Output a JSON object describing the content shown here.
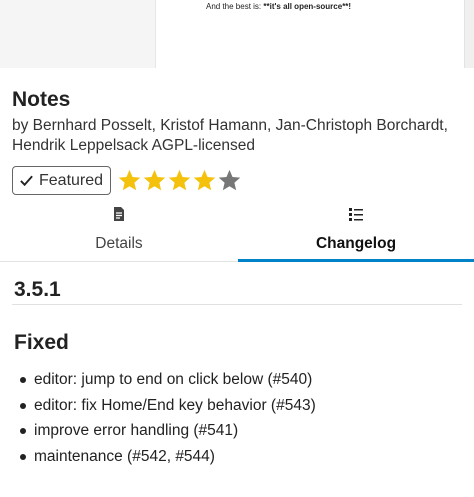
{
  "screenshot_strip": {
    "caption_prefix": "And the best is: ",
    "caption_bold": "**it's all open-source**!"
  },
  "app": {
    "title": "Notes",
    "authors": "by Bernhard Posselt, Kristof Hamann, Jan-Christoph Borchardt, Hendrik Leppelsack AGPL-licensed",
    "featured_label": "Featured",
    "featured_icon": "checkmark-icon",
    "rating": 4,
    "rating_max": 5,
    "star_color": "#f4c20d",
    "star_empty_color": "#777777"
  },
  "tabs": [
    {
      "label": "Details",
      "icon": "document-icon",
      "active": false
    },
    {
      "label": "Changelog",
      "icon": "list-icon",
      "active": true
    }
  ],
  "accent_color": "#0082c9",
  "changelog": {
    "version": "3.5.1",
    "section_title": "Fixed",
    "items": [
      "editor: jump to end on click below (#540)",
      "editor: fix Home/End key behavior (#543)",
      "improve error handling (#541)",
      "maintenance (#542, #544)"
    ]
  }
}
